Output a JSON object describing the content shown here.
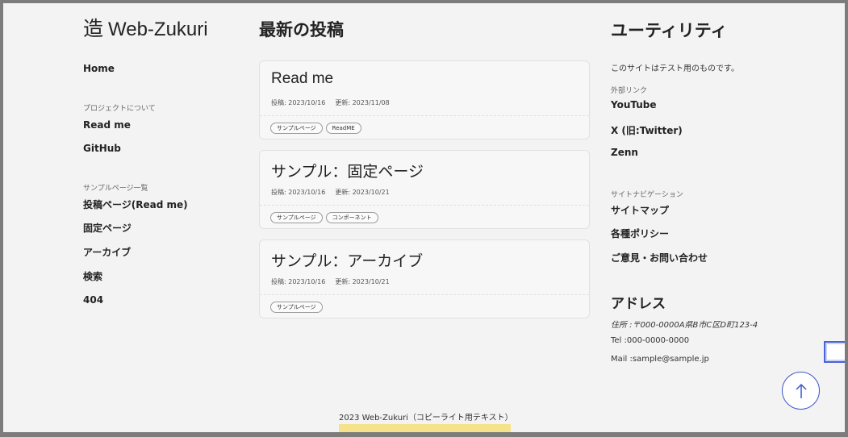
{
  "site": {
    "logo_mark": "造",
    "logo_text": "Web-Zukuri"
  },
  "left_nav": {
    "home": "Home",
    "project_caption": "プロジェクトについて",
    "project_links": [
      "Read me",
      "GitHub"
    ],
    "sample_caption": "サンプルページ一覧",
    "sample_links": [
      "投稿ページ(Read me)",
      "固定ページ",
      "アーカイブ",
      "検索",
      "404"
    ]
  },
  "main": {
    "title": "最新の投稿",
    "posts": [
      {
        "title": "Read me",
        "posted": "投稿: 2023/10/16",
        "updated": "更新: 2023/11/08",
        "tags": [
          "サンプルページ",
          "ReadME"
        ]
      },
      {
        "title": "サンプル：固定ページ",
        "posted": "投稿: 2023/10/16",
        "updated": "更新: 2023/10/21",
        "tags": [
          "サンプルページ",
          "コンポーネント"
        ]
      },
      {
        "title": "サンプル：アーカイブ",
        "posted": "投稿: 2023/10/16",
        "updated": "更新: 2023/10/21",
        "tags": [
          "サンプルページ"
        ]
      }
    ]
  },
  "utility": {
    "title": "ユーティリティ",
    "description": "このサイトはテスト用のものです。",
    "external_caption": "外部リンク",
    "external_links": [
      "YouTube",
      "X (旧:Twitter)",
      "Zenn"
    ],
    "sitenav_caption": "サイトナビゲーション",
    "sitenav_links": [
      "サイトマップ",
      "各種ポリシー",
      "ご意見・お問い合わせ"
    ],
    "address_title": "アドレス",
    "address": "住所 :〒000-0000A県B市C区D町123-4",
    "tel": "Tel :000-0000-0000",
    "mail": "Mail :sample@sample.jp"
  },
  "footer": {
    "copyright": "2023 Web-Zukuri（コピーライト用テキスト）"
  },
  "colors": {
    "accent": "#3b55c8",
    "footer_highlight": "#f6e28a",
    "background": "#f3f3f3"
  }
}
